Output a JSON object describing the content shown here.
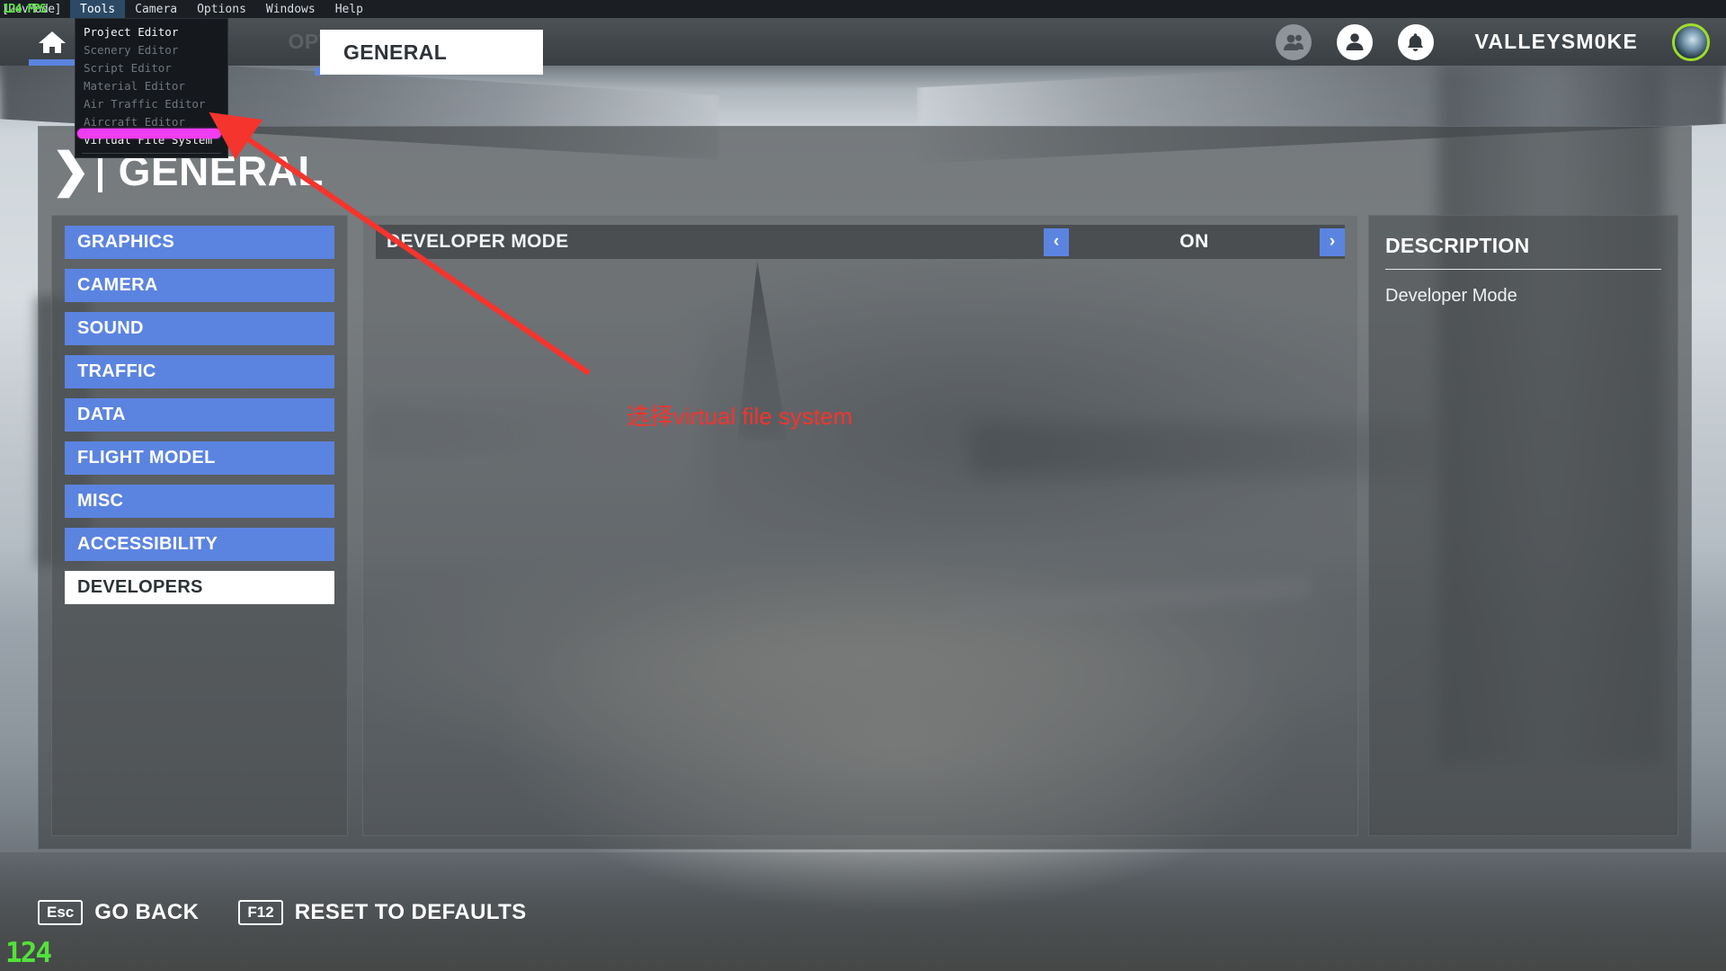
{
  "devbar": {
    "dev_tag": "[DevMode]",
    "fps_overlay": "124 FPS",
    "menus": [
      {
        "label": "Tools",
        "active": true
      },
      {
        "label": "Camera",
        "active": false
      },
      {
        "label": "Options",
        "active": false
      },
      {
        "label": "Windows",
        "active": false
      },
      {
        "label": "Help",
        "active": false
      }
    ]
  },
  "tools_menu": {
    "items": [
      {
        "label": "Project Editor",
        "enabled": true
      },
      {
        "label": "Scenery Editor",
        "enabled": false
      },
      {
        "label": "Script Editor",
        "enabled": false
      },
      {
        "label": "Material Editor",
        "enabled": false
      },
      {
        "label": "Air Traffic Editor",
        "enabled": false
      },
      {
        "label": "Aircraft Editor",
        "enabled": false
      },
      {
        "label": "Virtual File System",
        "enabled": true
      }
    ],
    "highlight_color": "#ef3df2"
  },
  "header": {
    "home_icon": "home-icon",
    "ghost_tab_label": "OPTIONS",
    "active_tab_label": "GENERAL",
    "friends_icon": "friends-icon",
    "profile_icon": "profile-icon",
    "notifications_icon": "bell-icon",
    "username": "VALLEYSM0KE",
    "avatar_ring_color": "#9ede2a"
  },
  "panel": {
    "title": "GENERAL",
    "sidebar": [
      {
        "label": "GRAPHICS",
        "selected": false
      },
      {
        "label": "CAMERA",
        "selected": false
      },
      {
        "label": "SOUND",
        "selected": false
      },
      {
        "label": "TRAFFIC",
        "selected": false
      },
      {
        "label": "DATA",
        "selected": false
      },
      {
        "label": "FLIGHT MODEL",
        "selected": false
      },
      {
        "label": "MISC",
        "selected": false
      },
      {
        "label": "ACCESSIBILITY",
        "selected": false
      },
      {
        "label": "DEVELOPERS",
        "selected": true
      }
    ],
    "settings": [
      {
        "label": "DEVELOPER MODE",
        "value": "ON",
        "prev_arrow": "‹",
        "next_arrow": "›"
      }
    ],
    "description": {
      "heading": "DESCRIPTION",
      "body": "Developer Mode"
    }
  },
  "bottom_bar": {
    "hints": [
      {
        "key": "Esc",
        "label": "GO BACK"
      },
      {
        "key": "F12",
        "label": "RESET TO DEFAULTS"
      }
    ],
    "fps_corner": "124"
  },
  "annotations": {
    "note_text": "选择virtual file system",
    "note_color": "#f5342d",
    "arrow_color": "#f5342d",
    "highlight_color": "#ef3df2"
  },
  "colors": {
    "accent_blue": "#5b84e0",
    "menu_active": "#2c4a66",
    "panel_bg": "#3f4244",
    "selected_nav": "#ffffff"
  }
}
